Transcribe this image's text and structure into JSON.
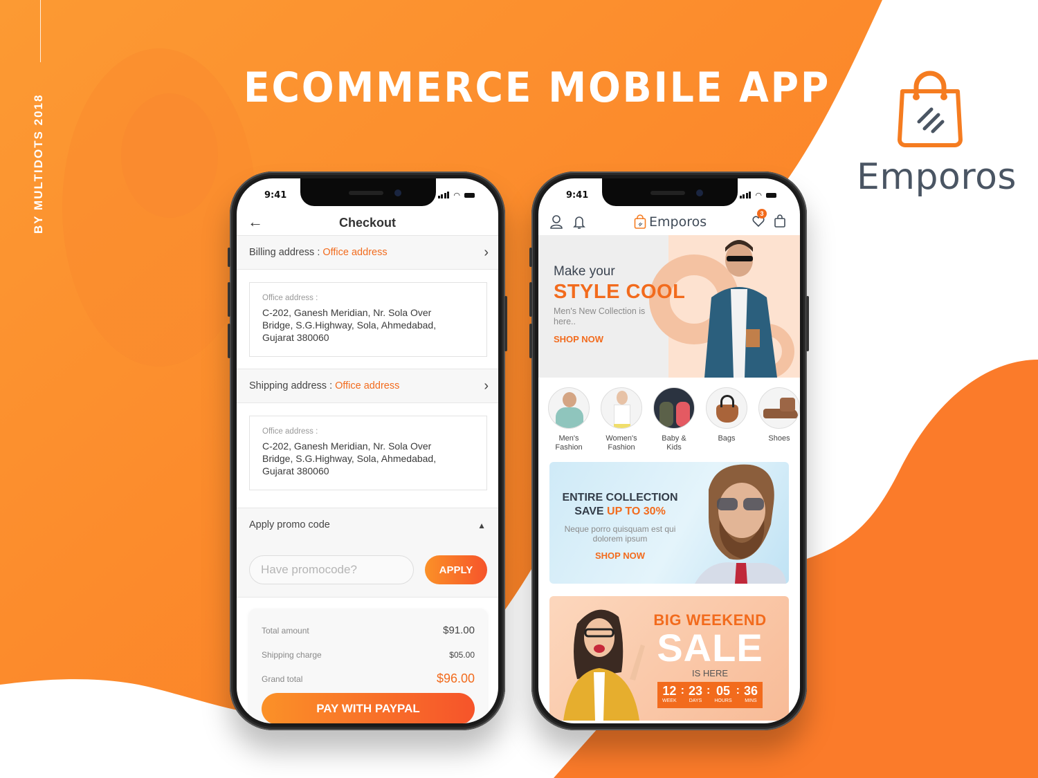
{
  "poster": {
    "side_credit": "BY MULTIDOTS 2018",
    "title": "ECOMMERCE MOBILE APP",
    "brand_name": "Emporos",
    "brand_color": "#f57c20",
    "text_color": "#4a5563"
  },
  "status_bar": {
    "time": "9:41"
  },
  "checkout": {
    "title": "Checkout",
    "billing": {
      "label": "Billing address :",
      "value": "Office address"
    },
    "billing_card": {
      "label": "Office address :",
      "lines": [
        "C-202, Ganesh Meridian, Nr. Sola Over",
        "Bridge, S.G.Highway, Sola, Ahmedabad,",
        "Gujarat 380060"
      ]
    },
    "shipping": {
      "label": "Shipping address :",
      "value": "Office address"
    },
    "shipping_card": {
      "label": "Office address :",
      "lines": [
        "C-202, Ganesh Meridian, Nr. Sola Over",
        "Bridge, S.G.Highway, Sola, Ahmedabad,",
        "Gujarat 380060"
      ]
    },
    "promo": {
      "title": "Apply promo code",
      "placeholder": "Have promocode?",
      "apply_label": "APPLY"
    },
    "summary": {
      "rows": [
        {
          "label": "Total amount",
          "value": "$91.00"
        },
        {
          "label": "Shipping charge",
          "value": "$05.00"
        },
        {
          "label": "Grand total",
          "value": "$96.00"
        }
      ]
    },
    "pay_label": "PAY WITH PAYPAL"
  },
  "home": {
    "logo_text": "Emporos",
    "wishlist_count": "3",
    "hero": {
      "pre": "Make your",
      "title": "STYLE COOL",
      "sub": "Men's New Collection is here..",
      "cta": "SHOP NOW"
    },
    "categories": [
      {
        "label_1": "Men's",
        "label_2": "Fashion"
      },
      {
        "label_1": "Women's",
        "label_2": "Fashion"
      },
      {
        "label_1": "Baby &",
        "label_2": "Kids"
      },
      {
        "label_1": "Bags",
        "label_2": ""
      },
      {
        "label_1": "Shoes",
        "label_2": ""
      }
    ],
    "collection_banner": {
      "line1": "ENTIRE COLLECTION",
      "line2_pre": "SAVE ",
      "line2_accent": "UP TO 30%",
      "sub": "Neque porro quisquam est qui dolorem ipsum",
      "cta": "SHOP NOW"
    },
    "sale_banner": {
      "pre": "BIG WEEKEND",
      "main": "SALE",
      "post": "IS HERE",
      "countdown": [
        {
          "value": "12",
          "label": "WEEK"
        },
        {
          "value": "23",
          "label": "DAYS"
        },
        {
          "value": "05",
          "label": "HOURS"
        },
        {
          "value": "36",
          "label": "MINS"
        }
      ]
    }
  }
}
